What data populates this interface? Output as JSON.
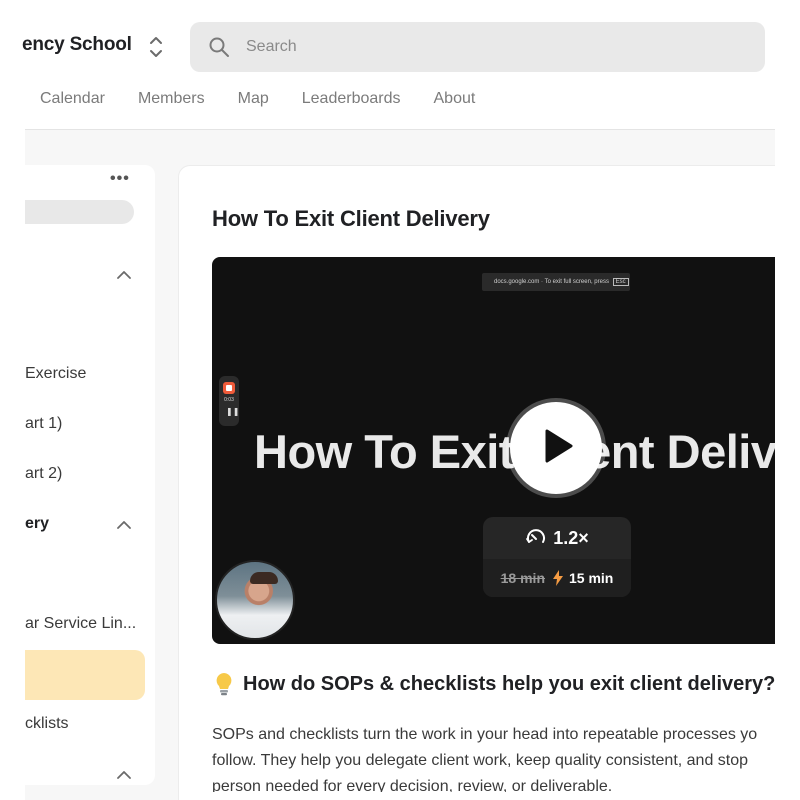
{
  "header": {
    "school_name": "ency School",
    "search_placeholder": "Search",
    "nav": [
      "Calendar",
      "Members",
      "Map",
      "Leaderboards",
      "About"
    ]
  },
  "sidebar": {
    "more_label": "•••",
    "items": [
      {
        "label": "Exercise"
      },
      {
        "label": "art 1)"
      },
      {
        "label": "art 2)"
      },
      {
        "label": "ery",
        "is_module": true
      },
      {
        "label": "ar Service Lin..."
      },
      {
        "label": "",
        "active": true
      },
      {
        "label": "cklists"
      }
    ]
  },
  "lesson": {
    "title": "How To Exit Client Delivery",
    "video": {
      "urlbar_text": "docs.google.com · To exit full screen, press",
      "urlbar_key": "Esc",
      "rec_time": "0:03",
      "big_title": "How To Exit Client Deliv",
      "speed": "1.2×",
      "old_duration": "18 min",
      "new_duration": "15 min"
    },
    "section_heading": "How do SOPs & checklists help you exit client delivery?",
    "body_lines": [
      "SOPs and checklists turn the work in your head into repeatable processes yo",
      "follow. They help you delegate client work, keep quality consistent, and stop",
      "person needed for every decision, review, or deliverable."
    ]
  },
  "colors": {
    "accent_active": "#fde7b6",
    "recording_red": "#ef5b3a",
    "bolt_orange": "#f59b42",
    "bulb_yellow": "#f7c948"
  },
  "icons": [
    "switcher-icon",
    "search-icon",
    "chevron-up-icon",
    "play-icon",
    "speed-icon",
    "bolt-icon",
    "lightbulb-icon"
  ]
}
